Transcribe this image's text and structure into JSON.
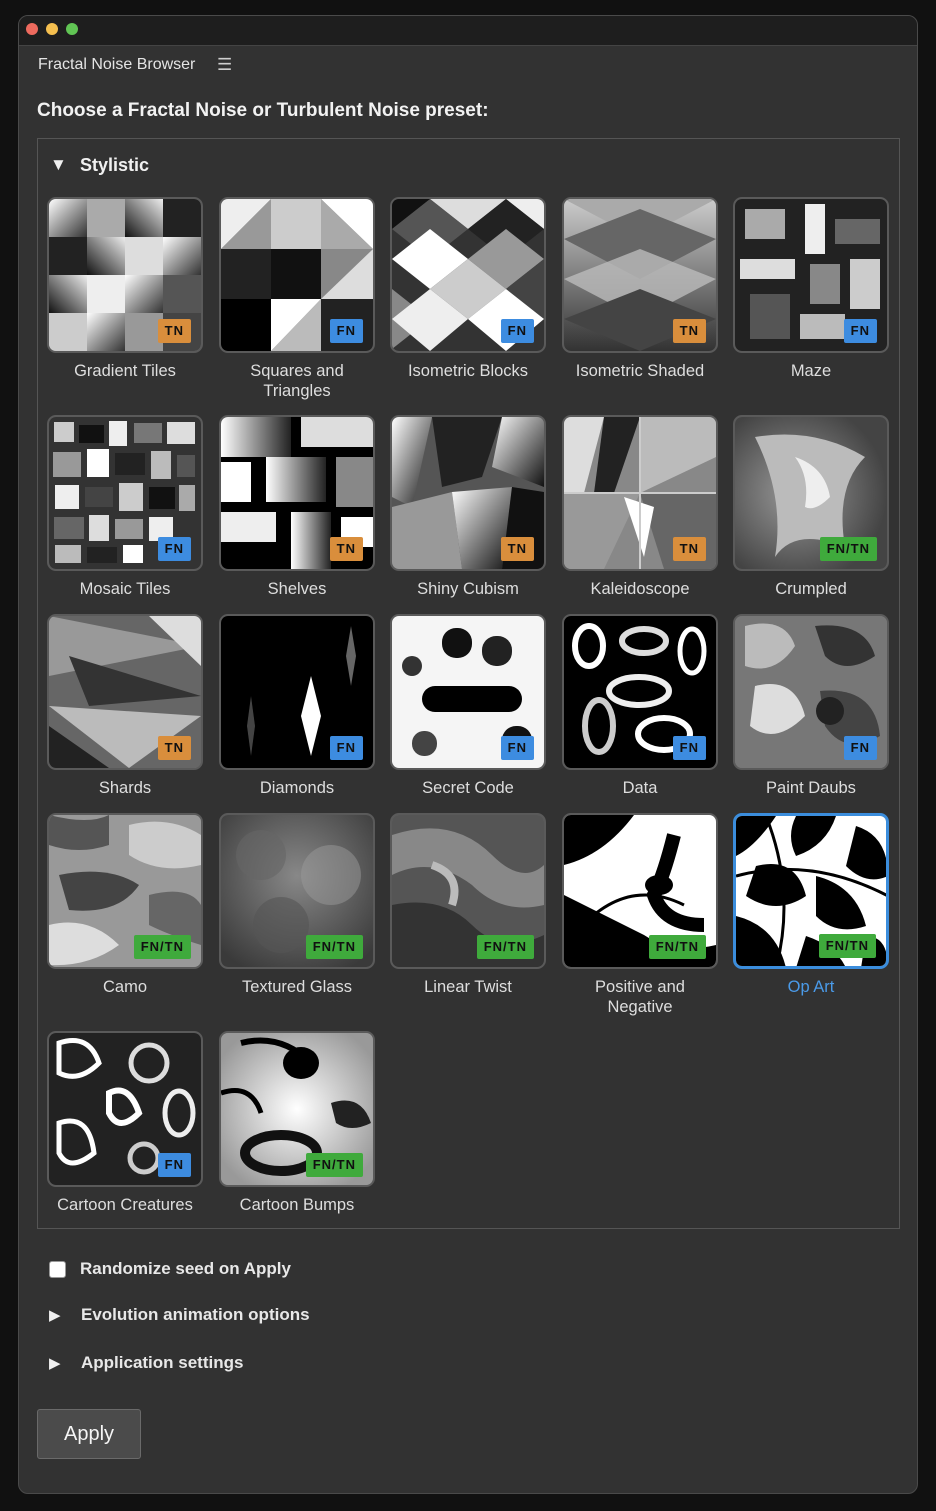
{
  "window": {
    "title": "Fractal Noise Browser"
  },
  "heading": "Choose a Fractal Noise or Turbulent Noise preset:",
  "section": {
    "title": "Stylistic",
    "presets": [
      {
        "label": "Gradient Tiles",
        "badge": "TN"
      },
      {
        "label": "Squares and Triangles",
        "badge": "FN"
      },
      {
        "label": "Isometric Blocks",
        "badge": "FN"
      },
      {
        "label": "Isometric Shaded",
        "badge": "TN"
      },
      {
        "label": "Maze",
        "badge": "FN"
      },
      {
        "label": "Mosaic Tiles",
        "badge": "FN"
      },
      {
        "label": "Shelves",
        "badge": "TN"
      },
      {
        "label": "Shiny Cubism",
        "badge": "TN"
      },
      {
        "label": "Kaleidoscope",
        "badge": "TN"
      },
      {
        "label": "Crumpled",
        "badge": "FN/TN"
      },
      {
        "label": "Shards",
        "badge": "TN"
      },
      {
        "label": "Diamonds",
        "badge": "FN"
      },
      {
        "label": "Secret Code",
        "badge": "FN"
      },
      {
        "label": "Data",
        "badge": "FN"
      },
      {
        "label": "Paint Daubs",
        "badge": "FN"
      },
      {
        "label": "Camo",
        "badge": "FN/TN"
      },
      {
        "label": "Textured Glass",
        "badge": "FN/TN"
      },
      {
        "label": "Linear Twist",
        "badge": "FN/TN"
      },
      {
        "label": "Positive and Negative",
        "badge": "FN/TN"
      },
      {
        "label": "Op Art",
        "badge": "FN/TN",
        "selected": true
      },
      {
        "label": "Cartoon Creatures",
        "badge": "FN"
      },
      {
        "label": "Cartoon Bumps",
        "badge": "FN/TN"
      }
    ]
  },
  "randomize": {
    "label": "Randomize seed on Apply",
    "checked": false
  },
  "expanders": [
    {
      "label": "Evolution animation options"
    },
    {
      "label": "Application settings"
    }
  ],
  "apply_label": "Apply",
  "colors": {
    "selected": "#3b8ddc",
    "tn_badge": "#d98e3c",
    "fn_badge": "#3d8ce0",
    "fntn_badge": "#3faa3c"
  }
}
